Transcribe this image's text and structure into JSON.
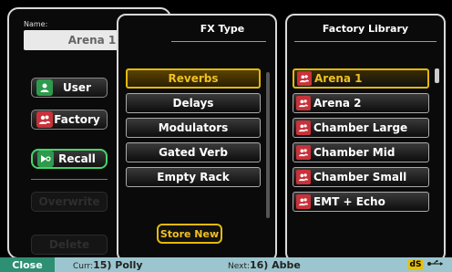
{
  "name": {
    "label": "Name:",
    "value": "Arena 1"
  },
  "side_buttons": {
    "user": "User",
    "factory": "Factory",
    "recall": "Recall",
    "overwrite": "Overwrite",
    "delete": "Delete"
  },
  "fx_type": {
    "title": "FX Type",
    "items": [
      "Reverbs",
      "Delays",
      "Modulators",
      "Gated Verb",
      "Empty Rack"
    ],
    "selected_index": 0,
    "store_new": "Store New"
  },
  "library": {
    "title": "Factory Library",
    "items": [
      "Arena 1",
      "Arena 2",
      "Chamber Large",
      "Chamber Mid",
      "Chamber Small",
      "EMT + Echo"
    ],
    "selected_index": 0
  },
  "status": {
    "close": "Close",
    "curr_label": "Curr:",
    "curr_value": "15) Polly",
    "next_label": "Next:",
    "next_value": "16) Abbe",
    "ds": "dS"
  },
  "colors": {
    "accent": "#e3b90c",
    "recall_border": "#46d46a",
    "status_bar": "#9cc6cf",
    "close_btn": "#2d8f73",
    "preset_icon": "#c8323a"
  }
}
